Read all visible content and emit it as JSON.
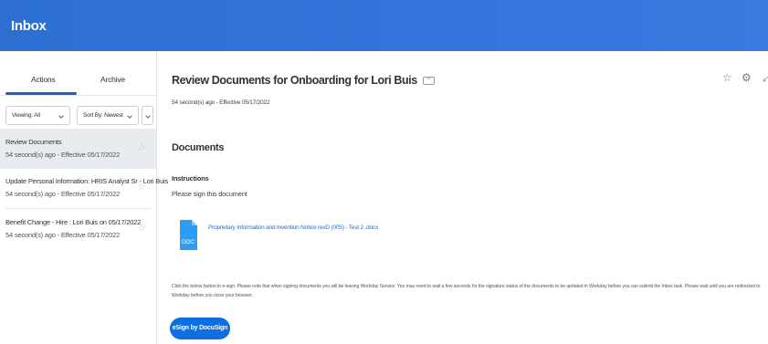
{
  "header": {
    "title": "Inbox",
    "background_color": "#3574db"
  },
  "sidebar": {
    "tabs": [
      {
        "label": "Actions",
        "active": true
      },
      {
        "label": "Archive",
        "active": false
      }
    ],
    "filters": {
      "viewing": "Viewing: All",
      "sort": "Sort By: Newest"
    },
    "items": [
      {
        "title": "Review Documents",
        "meta": "54 second(s) ago - Effective 05/17/2022",
        "selected": true
      },
      {
        "title": "Update Personal Information: HRIS Analyst Sr - Lori Buis",
        "meta": "54 second(s) ago - Effective 05/17/2022",
        "selected": false
      },
      {
        "title": "Benefit Change - Hire : Lori Buis on 05/17/2022",
        "meta": "54 second(s) ago - Effective 05/17/2022",
        "selected": false
      }
    ]
  },
  "main": {
    "title": "Review Documents for Onboarding for Lori Buis",
    "more_label": "···",
    "meta": "54 second(s) ago - Effective 05/17/2022",
    "section_title": "Documents",
    "instructions_label": "Instructions",
    "instructions_text": "Please sign this document",
    "file": {
      "icon": "doc-file-icon",
      "ext": "DOC",
      "name": "Proprietary Information and Invention Notice revD (005) - Test 2 .docx"
    },
    "notice": "Click the below button to e-sign. Please note that when signing documents you will be leaving Workday Service. You may need to wait a few seconds for the signature status of the documents to be updated in Workday before you can submit the Inbox task. Please wait until you are redirected to Workday before you close your browser.",
    "esign_label": "eSign by DocuSign",
    "accent_color": "#0d6fe0"
  },
  "icons": {
    "star": "☆",
    "gear": "⚙",
    "expand": "⤢"
  }
}
